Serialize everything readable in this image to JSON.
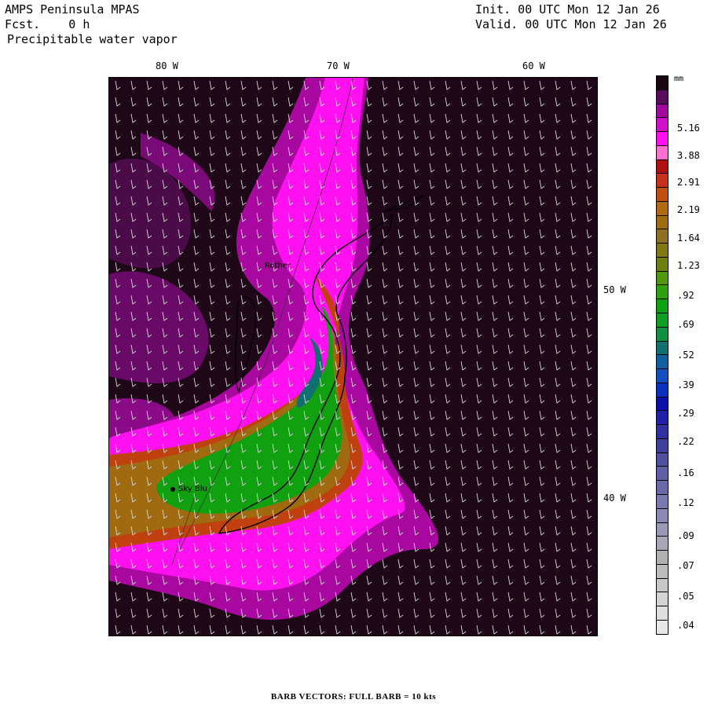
{
  "header": {
    "model": "AMPS Peninsula MPAS",
    "fcst": "Fcst.    0 h",
    "field": "Precipitable water vapor",
    "init": "Init. 00 UTC Mon 12 Jan 26",
    "valid": "Valid. 00 UTC Mon 12 Jan 26"
  },
  "axes": {
    "lon_labels": [
      "80 W",
      "70 W",
      "60 W"
    ],
    "lat_labels": [
      "50 W",
      "40 W"
    ]
  },
  "stations": {
    "rothera": "Rother",
    "sky_blu": "Sky Blu"
  },
  "colorbar": {
    "unit": "mm",
    "labels": [
      "5.16",
      "3.88",
      "2.91",
      "2.19",
      "1.64",
      "1.23",
      ".92",
      ".69",
      ".52",
      ".39",
      ".29",
      ".22",
      ".16",
      ".12",
      ".09",
      ".07",
      ".05",
      ".04"
    ],
    "colors": [
      "#1a0612",
      "#5a0a5a",
      "#a0089e",
      "#d010c8",
      "#ff10f0",
      "#ff70d0",
      "#b01010",
      "#c83018",
      "#c05010",
      "#b06a10",
      "#a06c10",
      "#907020",
      "#807810",
      "#708010",
      "#509810",
      "#30a010",
      "#10a010",
      "#10a020",
      "#109040",
      "#107070",
      "#1060a0",
      "#1050c0",
      "#0a30c0",
      "#0a10a8",
      "#2020a8",
      "#3030a0",
      "#40409c",
      "#5050a0",
      "#6060a8",
      "#6a6aa8",
      "#7a7ab0",
      "#8a8ab4",
      "#9a9ab8",
      "#a8a8b8",
      "#b0b0b0",
      "#bcbcbc",
      "#c8c8c8",
      "#d4d4d4",
      "#dedede",
      "#e8e8e8"
    ]
  },
  "footer": "BARB VECTORS:  FULL BARB = 10 kts"
}
